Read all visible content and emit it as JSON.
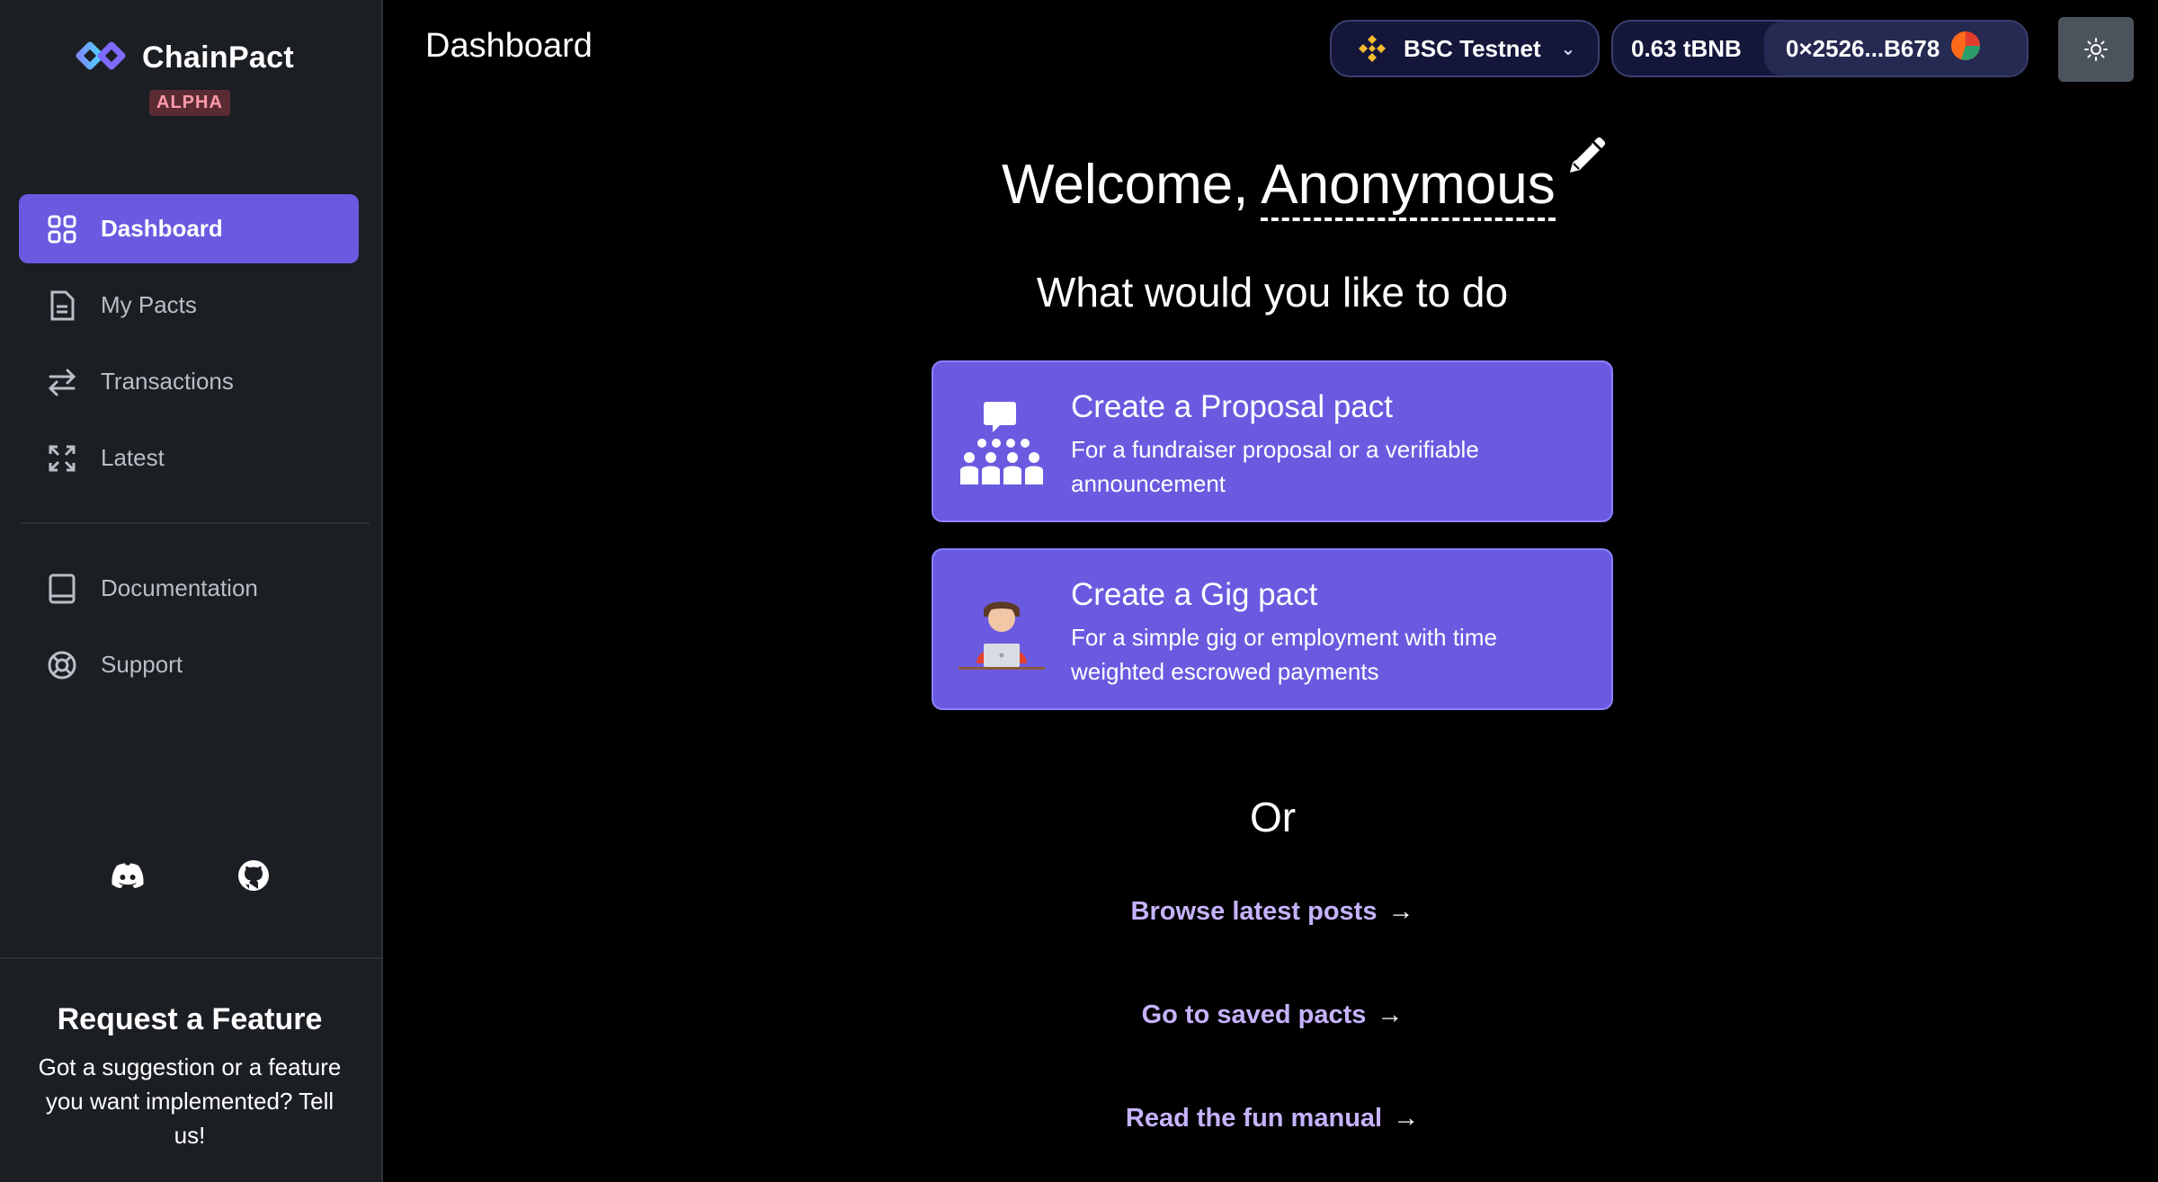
{
  "app": {
    "name": "ChainPact",
    "badge": "ALPHA"
  },
  "sidebar": {
    "items": [
      {
        "label": "Dashboard",
        "icon": "dashboard-grid-icon",
        "active": true
      },
      {
        "label": "My Pacts",
        "icon": "document-icon"
      },
      {
        "label": "Transactions",
        "icon": "swap-arrows-icon"
      },
      {
        "label": "Latest",
        "icon": "expand-icon"
      }
    ],
    "secondary": [
      {
        "label": "Documentation",
        "icon": "book-icon"
      },
      {
        "label": "Support",
        "icon": "lifebuoy-icon"
      }
    ],
    "socials": [
      "discord-icon",
      "github-icon"
    ],
    "feature": {
      "title": "Request a Feature",
      "text": "Got a suggestion or a feature you want implemented? Tell us!"
    }
  },
  "header": {
    "title": "Dashboard",
    "network": "BSC Testnet",
    "balance": "0.63 tBNB",
    "address": "0×2526...B678"
  },
  "main": {
    "welcome_prefix": "Welcome, ",
    "username": "Anonymous",
    "question": "What would you like to do",
    "cards": [
      {
        "title": "Create a Proposal pact",
        "desc": "For a fundraiser proposal or a verifiable announcement"
      },
      {
        "title": "Create a Gig pact",
        "desc": "For a simple gig or employment with time weighted escrowed payments"
      }
    ],
    "or": "Or",
    "links": [
      {
        "label": "Browse latest posts",
        "arrow": "→"
      },
      {
        "label": "Go to saved pacts",
        "arrow": "→"
      },
      {
        "label": "Read the fun manual",
        "arrow": "→"
      }
    ]
  },
  "colors": {
    "accent": "#6a5ae0",
    "sidebar_bg": "#1b1e22",
    "link": "#c5b3ff",
    "bnb": "#f3ba2f"
  }
}
